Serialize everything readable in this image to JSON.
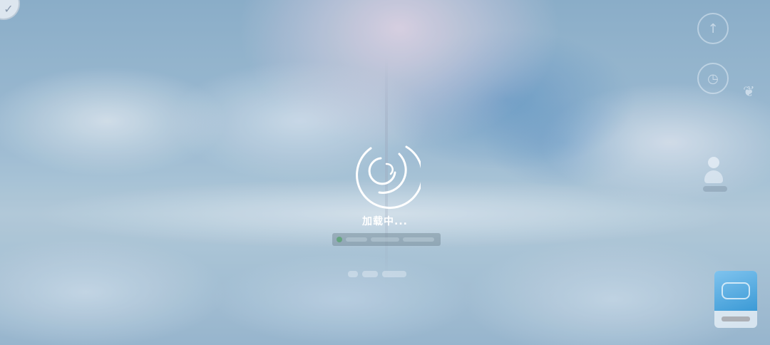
{
  "loading": {
    "text": "加载中...",
    "icon": "loading-spinner-icon"
  },
  "colors": {
    "loading_text": "#ffffff",
    "sky": "#9fc0d6"
  },
  "background_icons": [
    "badge-icon",
    "compass-icon",
    "clock-icon",
    "feather-icon",
    "avatar-icon",
    "promo-card-icon"
  ]
}
